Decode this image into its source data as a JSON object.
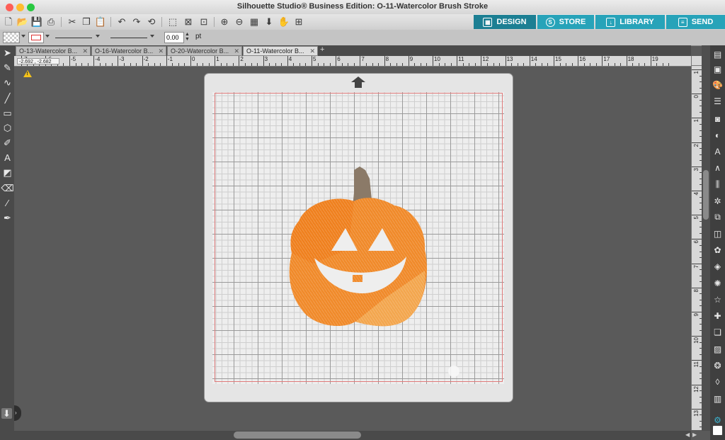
{
  "window": {
    "title": "Silhouette Studio® Business Edition: O-11-Watercolor Brush Stroke"
  },
  "nav_tabs": [
    {
      "label": "DESIGN",
      "icon": "design-grid-icon",
      "active": true
    },
    {
      "label": "STORE",
      "icon": "store-s-icon",
      "active": false
    },
    {
      "label": "LIBRARY",
      "icon": "library-download-icon",
      "active": false
    },
    {
      "label": "SEND",
      "icon": "send-cutter-icon",
      "active": false
    }
  ],
  "properties": {
    "line_width_value": "0.00",
    "line_width_unit": "pt"
  },
  "doc_tabs": [
    {
      "label": "O-13-Watercolor B...",
      "active": false
    },
    {
      "label": "O-16-Watercolor B...",
      "active": false
    },
    {
      "label": "O-20-Watercolor B...",
      "active": false
    },
    {
      "label": "O-11-Watercolor B...",
      "active": true
    }
  ],
  "add_tab_label": "+",
  "ruler": {
    "coordinates": "-2.692 , -2.682",
    "h_labels": [
      "-7",
      "-6",
      "-5",
      "-4",
      "-3",
      "-2",
      "-1",
      "0",
      "1",
      "2",
      "3",
      "4",
      "5",
      "6",
      "7",
      "8",
      "9",
      "10",
      "11",
      "12",
      "13",
      "14",
      "15",
      "16",
      "17",
      "18",
      "19"
    ],
    "v_labels": [
      "1",
      "0",
      "1",
      "2",
      "3",
      "4",
      "5",
      "6",
      "7",
      "8",
      "9",
      "10",
      "11",
      "12",
      "13"
    ]
  },
  "icons": {
    "warning": "warning-icon",
    "mat_feed_arrow": "mat-feed-arrow-icon"
  },
  "colors": {
    "accent": "#27a3b9",
    "accent_active": "#1c7f93",
    "pumpkin": "#f08a2a",
    "stem": "#8b7a68",
    "cut_border": "#e07b7b"
  }
}
